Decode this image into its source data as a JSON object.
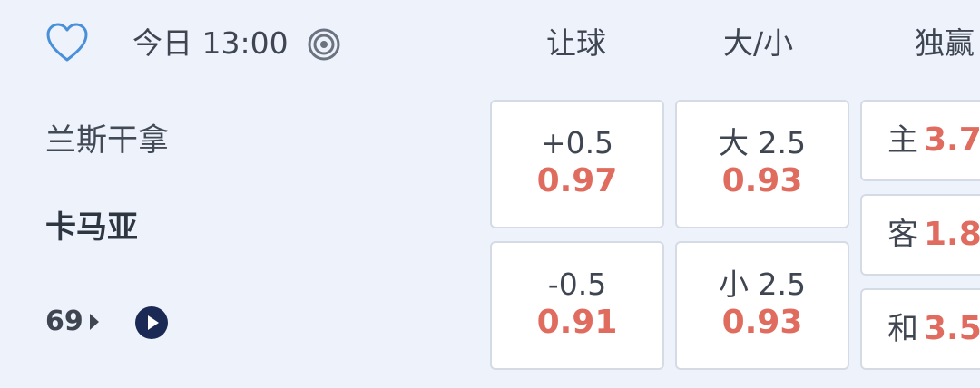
{
  "header": {
    "time_text": "今日 13:00",
    "col_handicap": "让球",
    "col_total": "大/小",
    "col_1x2": "独赢"
  },
  "match": {
    "home_team": "兰斯干拿",
    "away_team": "卡马亚",
    "more_count": "69"
  },
  "handicap": [
    {
      "line": "+0.5",
      "odds": "0.97"
    },
    {
      "line": "-0.5",
      "odds": "0.91"
    }
  ],
  "totals": [
    {
      "line": "大 2.5",
      "odds": "0.93"
    },
    {
      "line": "小 2.5",
      "odds": "0.93"
    }
  ],
  "one_x_two": [
    {
      "label": "主",
      "odds": "3.7"
    },
    {
      "label": "客",
      "odds": "1.8"
    },
    {
      "label": "和",
      "odds": "3.5"
    }
  ],
  "icons": {
    "favorite": "heart-outline-icon",
    "live_stats": "target-icon",
    "more": "caret-right-icon",
    "video": "play-circle-icon"
  },
  "colors": {
    "background": "#edf2fb",
    "odds": "#e06c5f",
    "heart": "#4a90d9",
    "play": "#1b2a55"
  }
}
